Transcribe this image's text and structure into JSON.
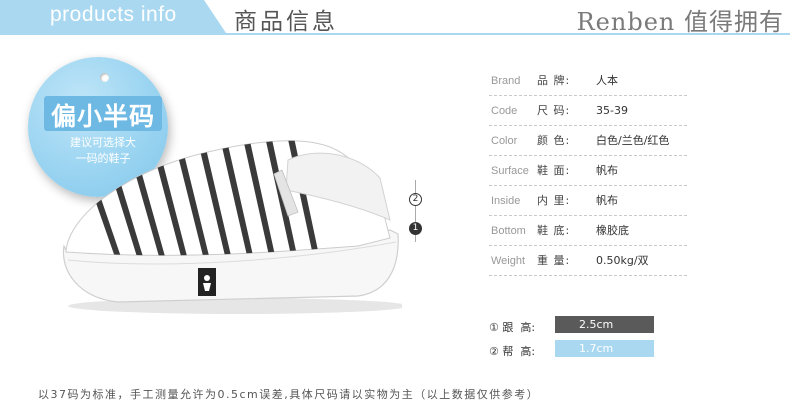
{
  "header": {
    "tab_title": "products info",
    "cn_title": "商品信息",
    "brand_slogan": "Renben 值得拥有",
    "accent_color": "#a9d8f0"
  },
  "badge": {
    "title": "偏小半码",
    "line1": "建议可选择大",
    "line2": "一码的鞋子",
    "color": "#9ad4f1"
  },
  "markers": {
    "two": "2",
    "one": "1"
  },
  "specs": [
    {
      "en": "Brand",
      "cn": "品  牌:",
      "value": "人本"
    },
    {
      "en": "Code",
      "cn": "尺  码:",
      "value": "35-39"
    },
    {
      "en": "Color",
      "cn": "颜  色:",
      "value": "白色/兰色/红色"
    },
    {
      "en": "Surface",
      "cn": "鞋  面:",
      "value": "帆布"
    },
    {
      "en": "Inside",
      "cn": "内  里:",
      "value": "帆布"
    },
    {
      "en": "Bottom",
      "cn": "鞋  底:",
      "value": "橡胶底"
    },
    {
      "en": "Weight",
      "cn": "重  量:",
      "value": "0.50kg/双"
    }
  ],
  "heights": [
    {
      "label": "① 跟  高:",
      "value": "2.5cm",
      "color": "#5a5a5a"
    },
    {
      "label": "② 帮  高:",
      "value": "1.7cm",
      "color": "#a9d8f0"
    }
  ],
  "footer_note": "以37码为标准，手工测量允许为0.5cm误差,具体尺码请以实物为主（以上数据仅供参考）"
}
